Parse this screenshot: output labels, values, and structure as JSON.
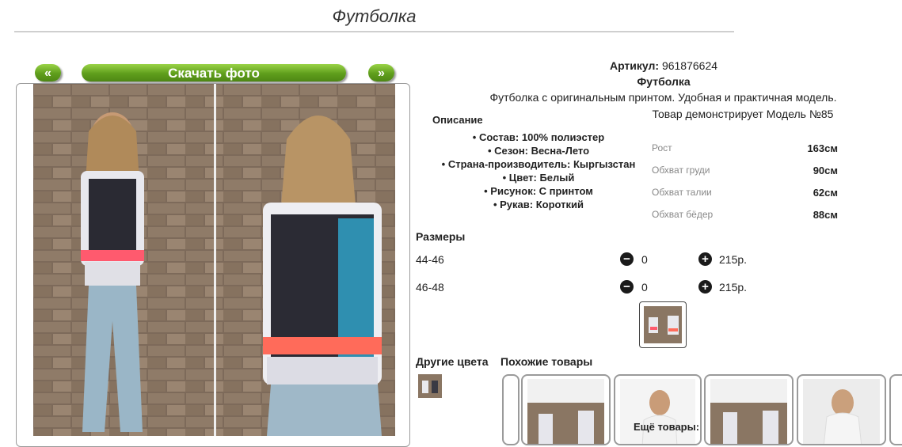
{
  "header": {
    "title": "Футболка"
  },
  "photo_nav": {
    "prev": "«",
    "download": "Скачать фото",
    "next": "»"
  },
  "product": {
    "sku_label": "Артикул:",
    "sku_value": "961876624",
    "name": "Футболка",
    "description": "Футболка с оригинальным принтом. Удобная и практичная модель.",
    "model_note": "Товар демонстрирует Модель №85"
  },
  "specs": {
    "heading": "Описание",
    "items": [
      "Состав: 100% полиэстер",
      "Сезон: Весна-Лето",
      "Страна-производитель: Кыргызстан",
      "Цвет: Белый",
      "Рисунок: С принтом",
      "Рукав: Короткий"
    ]
  },
  "measurements": [
    {
      "label": "Рост",
      "value": "163см"
    },
    {
      "label": "Обхват груди",
      "value": "90см"
    },
    {
      "label": "Обхват талии",
      "value": "62см"
    },
    {
      "label": "Обхват бёдер",
      "value": "88см"
    }
  ],
  "sizes": {
    "heading": "Размеры",
    "rows": [
      {
        "label": "44-46",
        "qty": "0",
        "price": "215р."
      },
      {
        "label": "46-48",
        "qty": "0",
        "price": "215р."
      }
    ],
    "minus_icon": "minus-circle-icon",
    "plus_icon": "plus-circle-icon"
  },
  "related": {
    "other_colors": "Другие цвета",
    "similar": "Похожие товары",
    "more": "Ещё товары:"
  },
  "colors": {
    "accent_green": "#5f9e1c",
    "accent_green_light": "#9ad347"
  }
}
